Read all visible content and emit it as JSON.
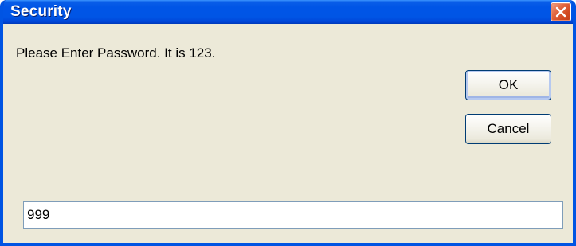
{
  "window": {
    "title": "Security",
    "close_icon": "close-icon"
  },
  "dialog": {
    "message": "Please Enter Password. It is 123.",
    "ok_label": "OK",
    "cancel_label": "Cancel",
    "password_value": "999"
  },
  "colors": {
    "titlebar": "#0055e5",
    "client_background": "#ece9d8",
    "close_button": "#d24a22",
    "window_border": "#0054e3"
  }
}
